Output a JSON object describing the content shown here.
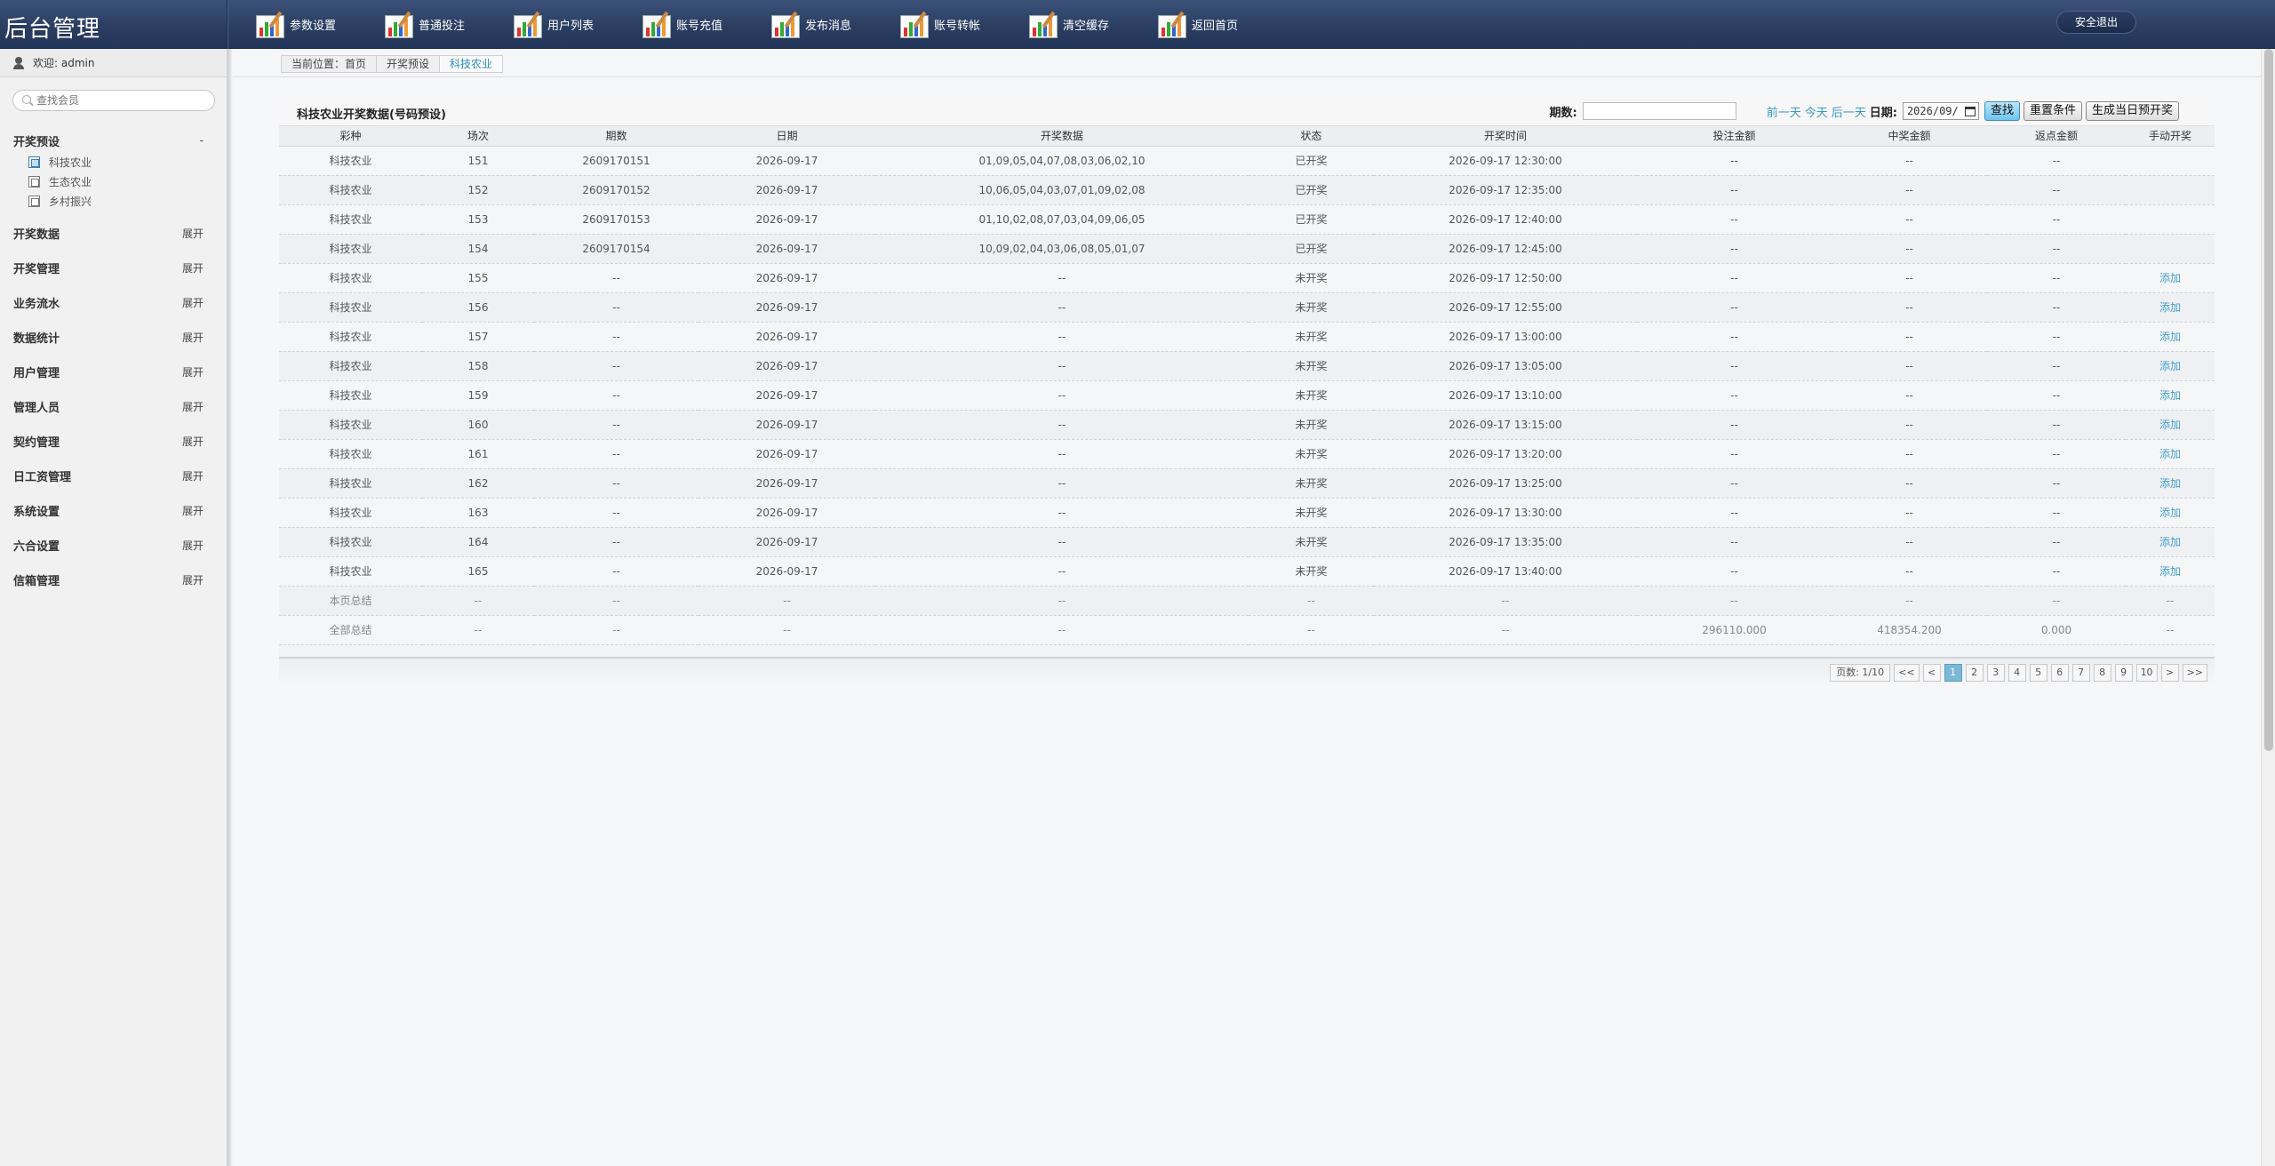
{
  "app_title": "后台管理",
  "top_nav": [
    {
      "label": "参数设置",
      "icon": "chart-icon"
    },
    {
      "label": "普通投注",
      "icon": "chart-icon"
    },
    {
      "label": "用户列表",
      "icon": "chart-icon"
    },
    {
      "label": "账号充值",
      "icon": "chart-icon"
    },
    {
      "label": "发布消息",
      "icon": "chart-icon"
    },
    {
      "label": "账号转帐",
      "icon": "chart-icon"
    },
    {
      "label": "清空缓存",
      "icon": "chart-icon"
    },
    {
      "label": "返回首页",
      "icon": "chart-icon"
    }
  ],
  "logout_label": "安全退出",
  "sidebar": {
    "welcome": "欢迎: admin",
    "search_placeholder": "查找会员",
    "open_menu": {
      "label": "开奖预设",
      "action": "-",
      "items": [
        {
          "label": "科技农业",
          "selected": true
        },
        {
          "label": "生态农业",
          "selected": false
        },
        {
          "label": "乡村振兴",
          "selected": false
        }
      ]
    },
    "menus": [
      {
        "label": "开奖数据",
        "action": "展开"
      },
      {
        "label": "开奖管理",
        "action": "展开"
      },
      {
        "label": "业务流水",
        "action": "展开"
      },
      {
        "label": "数据统计",
        "action": "展开"
      },
      {
        "label": "用户管理",
        "action": "展开"
      },
      {
        "label": "管理人员",
        "action": "展开"
      },
      {
        "label": "契约管理",
        "action": "展开"
      },
      {
        "label": "日工资管理",
        "action": "展开"
      },
      {
        "label": "系统设置",
        "action": "展开"
      },
      {
        "label": "六合设置",
        "action": "展开"
      },
      {
        "label": "信箱管理",
        "action": "展开"
      }
    ]
  },
  "breadcrumb": [
    "当前位置：首页",
    "开奖预设",
    "科技农业"
  ],
  "panel": {
    "title": "科技农业开奖数据(号码预设)",
    "period_label": "期数:",
    "period_value": "",
    "prev_day": "前一天",
    "today": "今天",
    "next_day": "后一天",
    "date_label": "日期:",
    "date_value": "2026/09/",
    "search_btn": "查找",
    "reset_btn": "重置条件",
    "generate_btn": "生成当日预开奖"
  },
  "table": {
    "columns": [
      "彩种",
      "场次",
      "期数",
      "日期",
      "开奖数据",
      "状态",
      "开奖时间",
      "投注金额",
      "中奖金额",
      "返点金额",
      "手动开奖"
    ],
    "rows": [
      [
        "科技农业",
        "151",
        "2609170151",
        "2026-09-17",
        "01,09,05,04,07,08,03,06,02,10",
        "已开奖",
        "2026-09-17 12:30:00",
        "--",
        "--",
        "--",
        ""
      ],
      [
        "科技农业",
        "152",
        "2609170152",
        "2026-09-17",
        "10,06,05,04,03,07,01,09,02,08",
        "已开奖",
        "2026-09-17 12:35:00",
        "--",
        "--",
        "--",
        ""
      ],
      [
        "科技农业",
        "153",
        "2609170153",
        "2026-09-17",
        "01,10,02,08,07,03,04,09,06,05",
        "已开奖",
        "2026-09-17 12:40:00",
        "--",
        "--",
        "--",
        ""
      ],
      [
        "科技农业",
        "154",
        "2609170154",
        "2026-09-17",
        "10,09,02,04,03,06,08,05,01,07",
        "已开奖",
        "2026-09-17 12:45:00",
        "--",
        "--",
        "--",
        ""
      ],
      [
        "科技农业",
        "155",
        "--",
        "2026-09-17",
        "--",
        "未开奖",
        "2026-09-17 12:50:00",
        "--",
        "--",
        "--",
        "添加"
      ],
      [
        "科技农业",
        "156",
        "--",
        "2026-09-17",
        "--",
        "未开奖",
        "2026-09-17 12:55:00",
        "--",
        "--",
        "--",
        "添加"
      ],
      [
        "科技农业",
        "157",
        "--",
        "2026-09-17",
        "--",
        "未开奖",
        "2026-09-17 13:00:00",
        "--",
        "--",
        "--",
        "添加"
      ],
      [
        "科技农业",
        "158",
        "--",
        "2026-09-17",
        "--",
        "未开奖",
        "2026-09-17 13:05:00",
        "--",
        "--",
        "--",
        "添加"
      ],
      [
        "科技农业",
        "159",
        "--",
        "2026-09-17",
        "--",
        "未开奖",
        "2026-09-17 13:10:00",
        "--",
        "--",
        "--",
        "添加"
      ],
      [
        "科技农业",
        "160",
        "--",
        "2026-09-17",
        "--",
        "未开奖",
        "2026-09-17 13:15:00",
        "--",
        "--",
        "--",
        "添加"
      ],
      [
        "科技农业",
        "161",
        "--",
        "2026-09-17",
        "--",
        "未开奖",
        "2026-09-17 13:20:00",
        "--",
        "--",
        "--",
        "添加"
      ],
      [
        "科技农业",
        "162",
        "--",
        "2026-09-17",
        "--",
        "未开奖",
        "2026-09-17 13:25:00",
        "--",
        "--",
        "--",
        "添加"
      ],
      [
        "科技农业",
        "163",
        "--",
        "2026-09-17",
        "--",
        "未开奖",
        "2026-09-17 13:30:00",
        "--",
        "--",
        "--",
        "添加"
      ],
      [
        "科技农业",
        "164",
        "--",
        "2026-09-17",
        "--",
        "未开奖",
        "2026-09-17 13:35:00",
        "--",
        "--",
        "--",
        "添加"
      ],
      [
        "科技农业",
        "165",
        "--",
        "2026-09-17",
        "--",
        "未开奖",
        "2026-09-17 13:40:00",
        "--",
        "--",
        "--",
        "添加"
      ]
    ],
    "summary_rows": [
      [
        "本页总结",
        "--",
        "--",
        "--",
        "--",
        "--",
        "--",
        "--",
        "--",
        "--",
        "--"
      ],
      [
        "全部总结",
        "--",
        "--",
        "--",
        "--",
        "--",
        "--",
        "296110.000",
        "418354.200",
        "0.000",
        "--"
      ]
    ]
  },
  "pager": {
    "info": "页数: 1/10",
    "first": "<<",
    "prev": "<",
    "pages": [
      "1",
      "2",
      "3",
      "4",
      "5",
      "6",
      "7",
      "8",
      "9",
      "10"
    ],
    "current": "1",
    "next": ">",
    "last": ">>"
  },
  "colors": {
    "topbar": "#2a3d60",
    "link": "#3a9ac9",
    "primary_btn": "#6cc4ee",
    "active_page": "#7ab8d6"
  }
}
